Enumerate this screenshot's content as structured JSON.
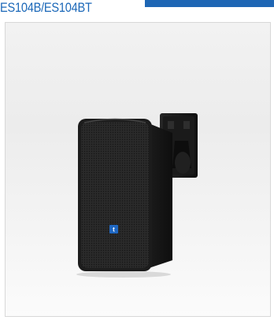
{
  "product": {
    "model_title": "ES104B/ES104BT",
    "image_alt": "Black wall-mount speaker with bracket",
    "brand_color": "#1e66b4"
  }
}
